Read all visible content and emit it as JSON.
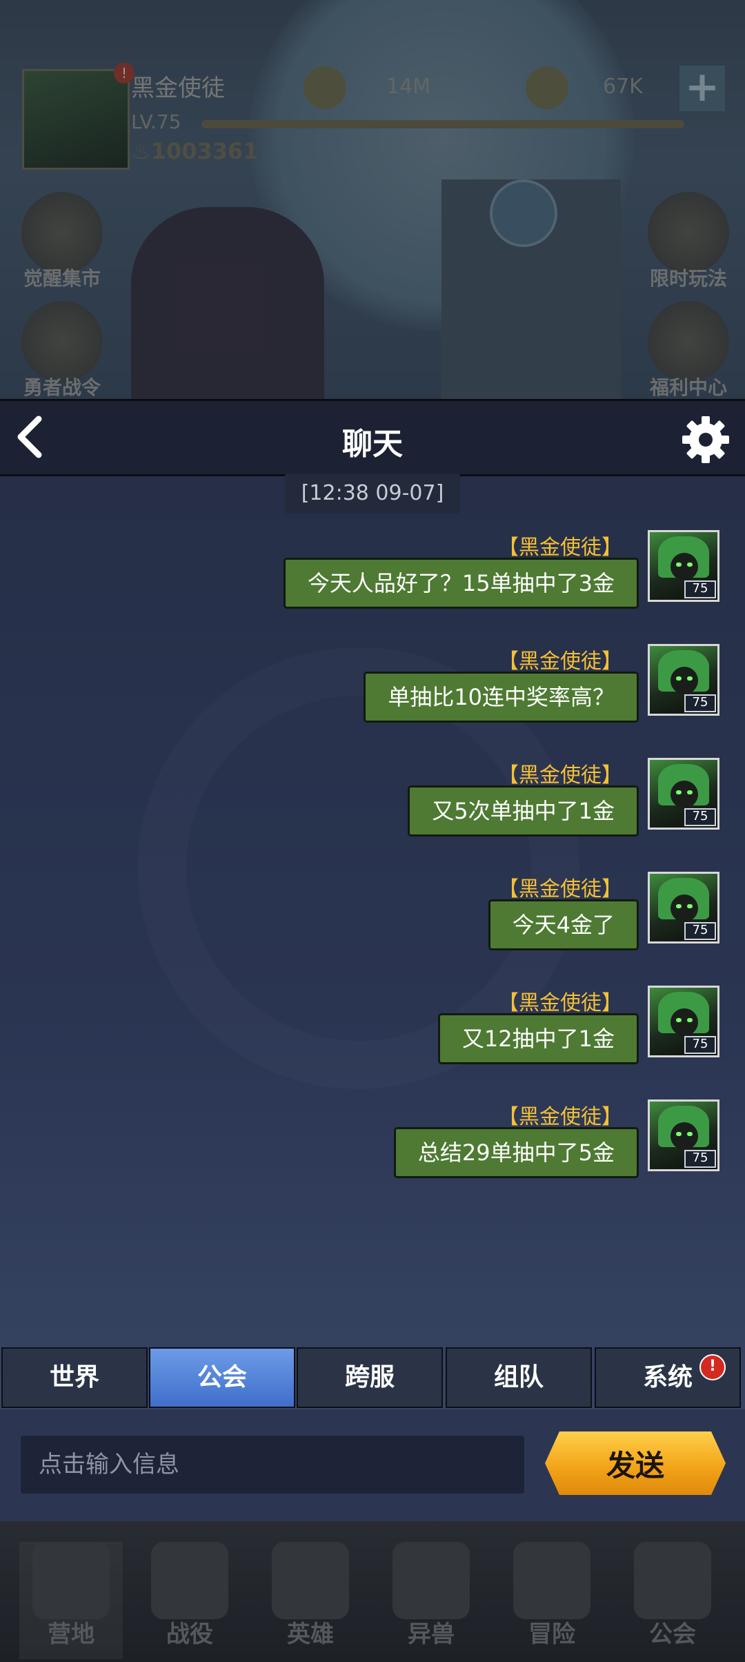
{
  "player": {
    "name": "黑金使徒",
    "level": "LV.75",
    "power": "1003361",
    "alert": "!",
    "level_progress": 1.0
  },
  "currencies": [
    {
      "icon": "gold-coin-icon",
      "value": "14M"
    },
    {
      "icon": "gear-coin-icon",
      "value": "67K"
    }
  ],
  "side_buttons": {
    "left": [
      "觉醒集市",
      "勇者战令"
    ],
    "right": [
      "限时玩法",
      "福利中心"
    ]
  },
  "chat": {
    "title": "聊天",
    "timestamp": "[12:38 09-07]",
    "messages": [
      {
        "sender": "【黑金使徒】",
        "text": "今天人品好了？15单抽中了3金",
        "avatar_level": "75"
      },
      {
        "sender": "【黑金使徒】",
        "text": "单抽比10连中奖率高？",
        "avatar_level": "75"
      },
      {
        "sender": "【黑金使徒】",
        "text": "又5次单抽中了1金",
        "avatar_level": "75"
      },
      {
        "sender": "【黑金使徒】",
        "text": "今天4金了",
        "avatar_level": "75"
      },
      {
        "sender": "【黑金使徒】",
        "text": "又12抽中了1金",
        "avatar_level": "75"
      },
      {
        "sender": "【黑金使徒】",
        "text": "总结29单抽中了5金",
        "avatar_level": "75"
      }
    ]
  },
  "tabs": [
    {
      "label": "世界",
      "active": false
    },
    {
      "label": "公会",
      "active": true
    },
    {
      "label": "跨服",
      "active": false
    },
    {
      "label": "组队",
      "active": false
    },
    {
      "label": "系统",
      "active": false,
      "alert": "!"
    }
  ],
  "input": {
    "placeholder": "点击输入信息",
    "send_label": "发送"
  },
  "bottom_nav": [
    "营地",
    "战役",
    "英雄",
    "异兽",
    "冒险",
    "公会"
  ],
  "colors": {
    "bubble": "#4e7a33",
    "sender_name": "#f5c035",
    "active_tab": "#5a86d9",
    "send_button": "#f3a51a",
    "alert": "#d5291f"
  }
}
